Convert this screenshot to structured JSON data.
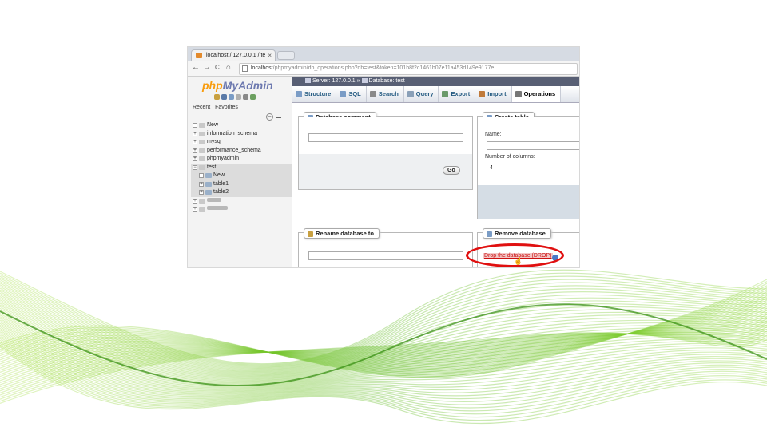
{
  "browser": {
    "tab_title": "localhost / 127.0.0.1 / te",
    "tab_close": "×",
    "nav_buttons": [
      "←",
      "→",
      "C",
      "⌂"
    ],
    "url_host": "localhost",
    "url_path": "/phpmyadmin/db_operations.php?db=test&token=101b8f2c1461b07e11a453d149e9177e"
  },
  "sidebar": {
    "logo_php": "php",
    "logo_myadmin": "MyAdmin",
    "tabs": [
      "Recent",
      "Favorites"
    ],
    "tree": [
      {
        "label": "New",
        "expander": "",
        "child": false,
        "selected": false
      },
      {
        "label": "information_schema",
        "expander": "+",
        "child": false,
        "selected": false
      },
      {
        "label": "mysql",
        "expander": "+",
        "child": false,
        "selected": false
      },
      {
        "label": "performance_schema",
        "expander": "+",
        "child": false,
        "selected": false
      },
      {
        "label": "phpmyadmin",
        "expander": "+",
        "child": false,
        "selected": false
      },
      {
        "label": "test",
        "expander": "−",
        "child": false,
        "selected": true
      },
      {
        "label": "New",
        "expander": "",
        "child": true,
        "selected": true
      },
      {
        "label": "table1",
        "expander": "+",
        "child": true,
        "selected": true
      },
      {
        "label": "table2",
        "expander": "+",
        "child": true,
        "selected": true
      }
    ]
  },
  "breadcrumb": {
    "server": "Server: 127.0.0.1",
    "separator": "»",
    "database": "Database: test"
  },
  "tabs": [
    {
      "label": "Structure",
      "icon": "structure-icon",
      "color": "#7a9cc6",
      "active": false
    },
    {
      "label": "SQL",
      "icon": "sql-icon",
      "color": "#7a9cc6",
      "active": false
    },
    {
      "label": "Search",
      "icon": "search-icon",
      "color": "#8a8a8a",
      "active": false
    },
    {
      "label": "Query",
      "icon": "query-icon",
      "color": "#8aa0b8",
      "active": false
    },
    {
      "label": "Export",
      "icon": "export-icon",
      "color": "#6a9a6a",
      "active": false
    },
    {
      "label": "Import",
      "icon": "import-icon",
      "color": "#c07a3a",
      "active": false
    },
    {
      "label": "Operations",
      "icon": "wrench-icon",
      "color": "#777777",
      "active": true
    }
  ],
  "panels": {
    "database_comment": {
      "legend": "Database comment",
      "go_label": "Go"
    },
    "create_table": {
      "legend": "Create table",
      "name_label": "Name:",
      "columns_label": "Number of columns:",
      "columns_value": "4"
    },
    "rename_database": {
      "legend": "Rename database to"
    },
    "remove_database": {
      "legend": "Remove database",
      "drop_link": "Drop the database (DROP)"
    }
  },
  "colors": {
    "highlight_oval": "#e01010",
    "tab_text": "#235a81",
    "breadcrumb_bg": "#585f74",
    "wave_green": "#6cc21e"
  }
}
